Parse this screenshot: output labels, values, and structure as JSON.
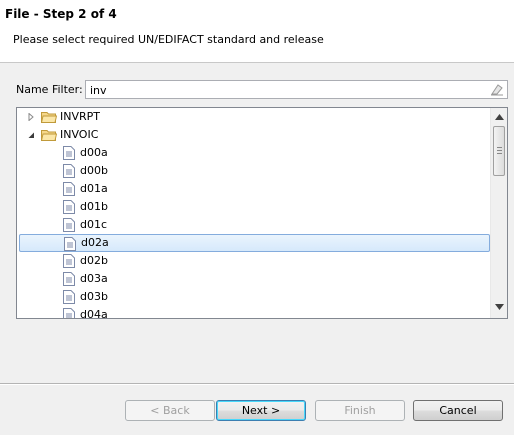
{
  "header": {
    "title": "File - Step 2 of 4",
    "subtitle": "Please select required UN/EDIFACT standard and release"
  },
  "filter": {
    "label": "Name Filter:",
    "value": "inv"
  },
  "tree": {
    "groups": [
      {
        "label": "INVRPT",
        "expanded": false
      },
      {
        "label": "INVOIC",
        "expanded": true
      }
    ],
    "children": [
      "d00a",
      "d00b",
      "d01a",
      "d01b",
      "d01c",
      "d02a",
      "d02b",
      "d03a",
      "d03b",
      "d04a"
    ],
    "selected": "d02a"
  },
  "buttons": {
    "back": "< Back",
    "next": "Next >",
    "finish": "Finish",
    "cancel": "Cancel"
  },
  "icons": {
    "expand": "triangle-right-icon",
    "collapse": "triangle-down-icon",
    "folder": "folder-icon",
    "file": "document-icon",
    "clear": "eraser-icon"
  }
}
